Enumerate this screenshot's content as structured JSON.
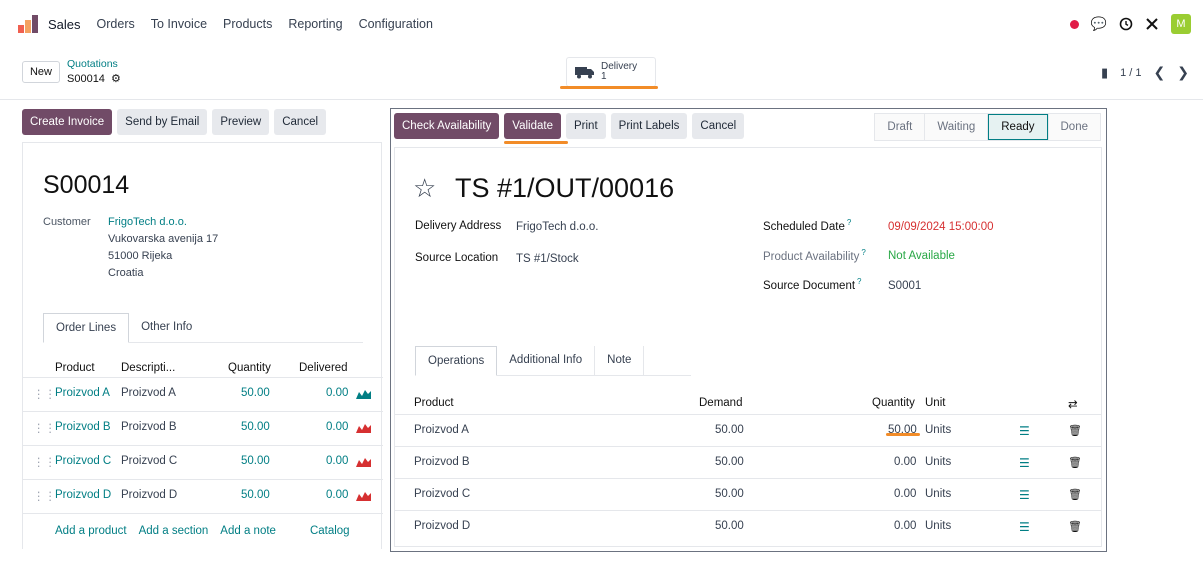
{
  "topbar": {
    "app_name": "Sales",
    "menu": [
      "Orders",
      "To Invoice",
      "Products",
      "Reporting",
      "Configuration"
    ],
    "avatar_letter": "M",
    "icons": [
      "activity-dot-icon",
      "chat-icon",
      "clock-icon",
      "tools-icon"
    ]
  },
  "controlbar": {
    "new_label": "New",
    "breadcrumb_parent": "Quotations",
    "breadcrumb_current": "S00014",
    "smart_button": {
      "label": "Delivery",
      "count": "1"
    },
    "pager": "1 / 1"
  },
  "sale_order": {
    "actions": [
      "Create Invoice",
      "Send by Email",
      "Preview",
      "Cancel"
    ],
    "name": "S00014",
    "customer_label": "Customer",
    "customer_name": "FrigoTech d.o.o.",
    "address": [
      "Vukovarska avenija 17",
      "51000 Rijeka",
      "Croatia"
    ],
    "tabs": [
      "Order Lines",
      "Other Info"
    ],
    "columns": [
      "Product",
      "Descripti...",
      "Quantity",
      "Delivered"
    ],
    "lines": [
      {
        "product": "Proizvod A",
        "description": "Proizvod A",
        "quantity": "50.00",
        "delivered": "0.00",
        "forecast": "available"
      },
      {
        "product": "Proizvod B",
        "description": "Proizvod B",
        "quantity": "50.00",
        "delivered": "0.00",
        "forecast": "unavailable"
      },
      {
        "product": "Proizvod C",
        "description": "Proizvod C",
        "quantity": "50.00",
        "delivered": "0.00",
        "forecast": "unavailable"
      },
      {
        "product": "Proizvod D",
        "description": "Proizvod D",
        "quantity": "50.00",
        "delivered": "0.00",
        "forecast": "unavailable"
      }
    ],
    "footer_links": [
      "Add a product",
      "Add a section",
      "Add a note",
      "Catalog"
    ]
  },
  "picking": {
    "actions": [
      "Check Availability",
      "Validate",
      "Print",
      "Print Labels",
      "Cancel"
    ],
    "statuses": [
      "Draft",
      "Waiting",
      "Ready",
      "Done"
    ],
    "active_status": "Ready",
    "name": "TS #1/OUT/00016",
    "delivery_address_label": "Delivery Address",
    "delivery_address": "FrigoTech d.o.o.",
    "source_location_label": "Source Location",
    "source_location": "TS #1/Stock",
    "scheduled_date_label": "Scheduled Date",
    "scheduled_date": "09/09/2024 15:00:00",
    "product_availability_label": "Product Availability",
    "product_availability": "Not Available",
    "source_document_label": "Source Document",
    "source_document": "S0001",
    "tabs": [
      "Operations",
      "Additional Info",
      "Note"
    ],
    "columns": [
      "Product",
      "Demand",
      "Quantity",
      "Unit"
    ],
    "lines": [
      {
        "product": "Proizvod A",
        "demand": "50.00",
        "quantity": "50.00",
        "unit": "Units"
      },
      {
        "product": "Proizvod B",
        "demand": "50.00",
        "quantity": "0.00",
        "unit": "Units"
      },
      {
        "product": "Proizvod C",
        "demand": "50.00",
        "quantity": "0.00",
        "unit": "Units"
      },
      {
        "product": "Proizvod D",
        "demand": "50.00",
        "quantity": "0.00",
        "unit": "Units"
      }
    ]
  },
  "colors": {
    "primary": "#714b67",
    "accent": "#017e84",
    "highlight": "#f28c28",
    "danger": "#d63031",
    "success": "#28a745"
  }
}
